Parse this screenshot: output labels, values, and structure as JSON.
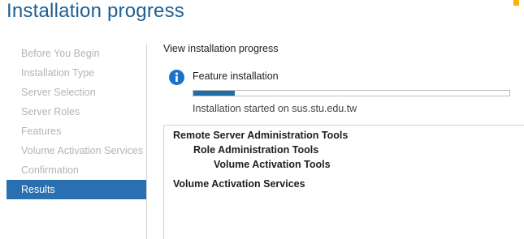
{
  "header": {
    "title": "Installation progress"
  },
  "nav": {
    "items": [
      {
        "label": "Before You Begin",
        "active": false
      },
      {
        "label": "Installation Type",
        "active": false
      },
      {
        "label": "Server Selection",
        "active": false
      },
      {
        "label": "Server Roles",
        "active": false
      },
      {
        "label": "Features",
        "active": false
      },
      {
        "label": "Volume Activation Services",
        "active": false
      },
      {
        "label": "Confirmation",
        "active": false
      },
      {
        "label": "Results",
        "active": true
      }
    ]
  },
  "main": {
    "section_label": "View installation progress",
    "status": {
      "icon": "info-icon",
      "title": "Feature installation",
      "progress_fraction": 0.13,
      "message": "Installation started on sus.stu.edu.tw"
    },
    "features": [
      {
        "label": "Remote Server Administration Tools",
        "level": 0
      },
      {
        "label": "Role Administration Tools",
        "level": 1
      },
      {
        "label": "Volume Activation Tools",
        "level": 2
      },
      {
        "label": "Volume Activation Services",
        "level": 0
      }
    ]
  },
  "colors": {
    "title": "#1e5f93",
    "active_nav": "#2a6fb0",
    "progress": "#1c6ea4",
    "info_icon": "#1a73c8"
  }
}
